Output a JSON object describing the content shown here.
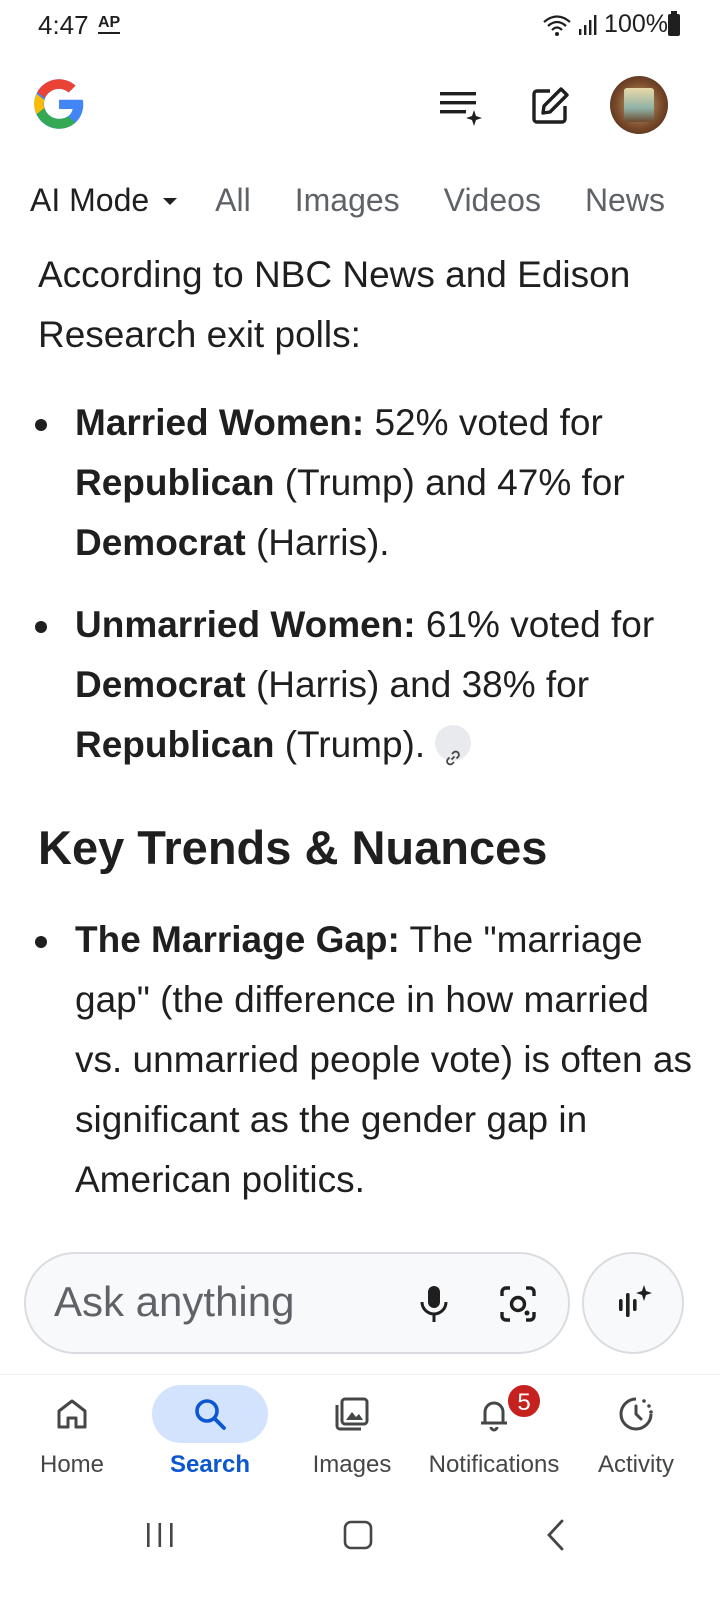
{
  "status_bar": {
    "time": "4:47",
    "carrier_badge": "AP",
    "battery": "100%"
  },
  "header": {
    "logo": "google-g-logo",
    "icons": [
      "history-sparkle-icon",
      "edit-icon",
      "avatar"
    ]
  },
  "tabs": [
    {
      "label": "AI Mode",
      "active": true
    },
    {
      "label": "All"
    },
    {
      "label": "Images"
    },
    {
      "label": "Videos"
    },
    {
      "label": "News"
    }
  ],
  "content": {
    "intro": "According to NBC News and Edison Research exit polls:",
    "poll_bullets": [
      {
        "lead": "Married Women:",
        "t1": " 52% voted for ",
        "b1": "Republican",
        "t2": " (Trump) and 47% for ",
        "b2": "Democrat",
        "t3": " (Harris)."
      },
      {
        "lead": "Unmarried Women:",
        "t1": " 61% voted for ",
        "b1": "Democrat",
        "t2": " (Harris) and 38% for ",
        "b2": "Republican",
        "t3": " (Trump)."
      }
    ],
    "section_heading": "Key Trends & Nuances",
    "trend_bullets": [
      {
        "lead": "The Marriage Gap:",
        "text": " The \"marriage gap\" (the difference in how married vs. unmarried people vote) is often as significant as the gender gap in American politics."
      }
    ]
  },
  "ask_bar": {
    "placeholder": "Ask anything"
  },
  "bottom_nav": [
    {
      "label": "Home",
      "icon": "home-icon"
    },
    {
      "label": "Search",
      "icon": "search-icon",
      "active": true
    },
    {
      "label": "Images",
      "icon": "images-icon"
    },
    {
      "label": "Notifications",
      "icon": "bell-icon",
      "badge": "5"
    },
    {
      "label": "Activity",
      "icon": "activity-icon"
    }
  ],
  "colors": {
    "accent": "#0b57d0",
    "active_pill": "#d3e3fd",
    "badge": "#c5221f"
  }
}
